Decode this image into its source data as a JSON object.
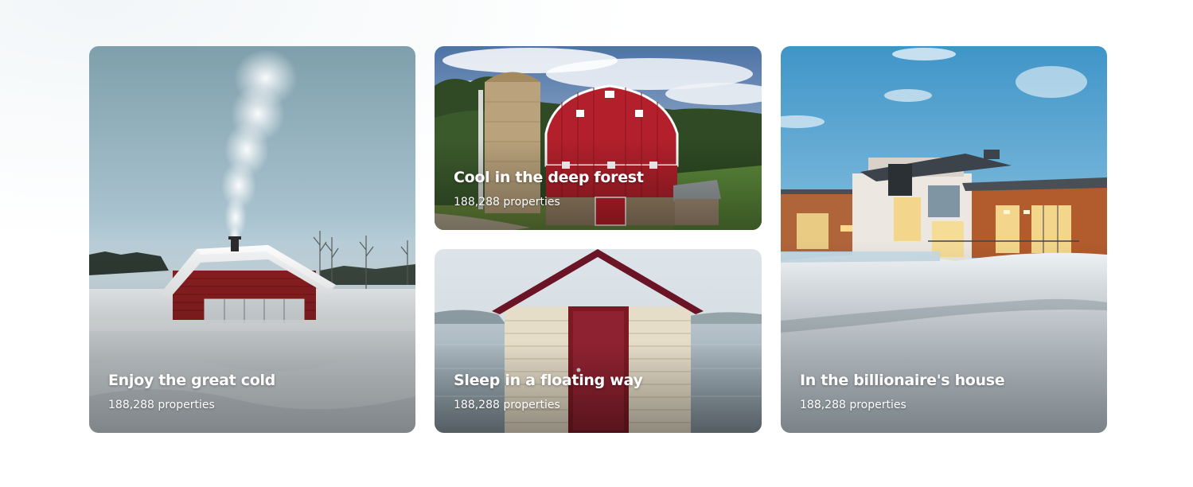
{
  "cards": [
    {
      "title": "Enjoy the great cold",
      "count": "188,288 properties",
      "image": "snow-cabin-photo"
    },
    {
      "title": "Cool in the deep forest",
      "count": "188,288 properties",
      "image": "red-barn-photo"
    },
    {
      "title": "Sleep in a floating way",
      "count": "188,288 properties",
      "image": "lake-shed-photo"
    },
    {
      "title": "In the billionaire's house",
      "count": "188,288 properties",
      "image": "modern-villa-photo"
    }
  ],
  "colors": {
    "text": "#ffffff",
    "barn_red": "#b3202b",
    "sky": "#8fb3c8"
  }
}
